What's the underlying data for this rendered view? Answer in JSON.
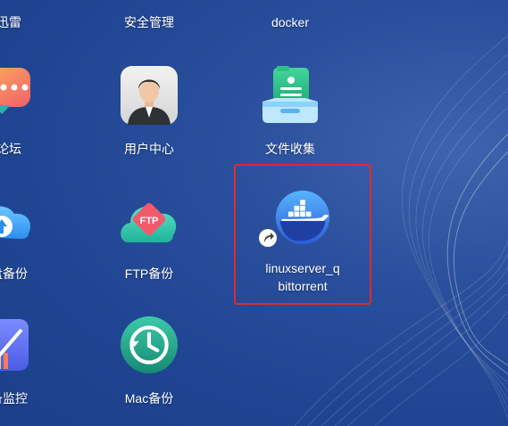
{
  "apps": {
    "thunder": {
      "label": "迅雷"
    },
    "security": {
      "label": "安全管理"
    },
    "docker": {
      "label": "docker"
    },
    "forum": {
      "label": "论坛"
    },
    "user_center": {
      "label": "用户中心"
    },
    "file_collect": {
      "label": "文件收集"
    },
    "cloud_backup": {
      "label": "盘备份"
    },
    "ftp_backup": {
      "label": "FTP备份",
      "icon_text": "FTP"
    },
    "qbittorrent": {
      "label_line1": "linuxserver_q",
      "label_line2": "bittorrent"
    },
    "monitor": {
      "label": "备监控"
    },
    "mac_backup": {
      "label": "Mac备份"
    }
  },
  "icons": [
    "speech-bubble-icon",
    "user-avatar-icon",
    "file-inbox-icon",
    "cloud-upload-icon",
    "ftp-cloud-icon",
    "docker-whale-icon",
    "shortcut-arrow-icon",
    "chart-check-icon",
    "time-machine-icon"
  ],
  "colors": {
    "selection": "#e02a2a",
    "desktop": "#2a4f9c"
  }
}
